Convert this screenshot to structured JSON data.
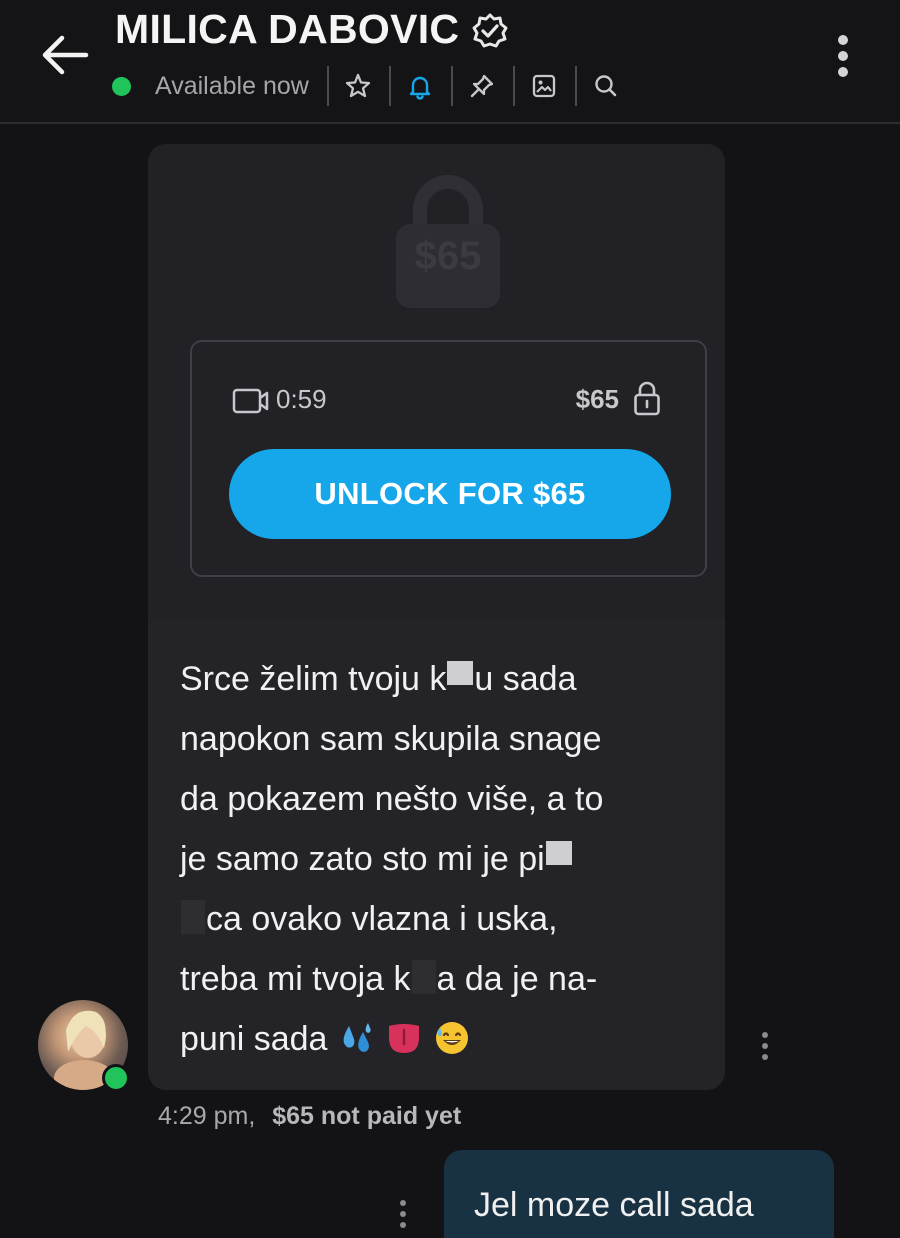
{
  "header": {
    "back_label": "Back",
    "title": "MILICA DABOVIC",
    "status": "Available now",
    "icons": [
      "star-icon",
      "bell-icon",
      "pin-icon",
      "gallery-icon",
      "search-icon"
    ],
    "menu_icon": "more-vertical-icon"
  },
  "locked_media": {
    "background_price": "$65",
    "duration": "0:59",
    "price": "$65",
    "unlock_label": "UNLOCK FOR $65"
  },
  "message": {
    "lines": [
      [
        "Srce želim tvoju k",
        "u sada"
      ],
      [
        "napokon sam skupila snage"
      ],
      [
        "da pokazem nešto više, a to"
      ],
      [
        "je samo zato sto mi je pi"
      ],
      [
        "ca ovako vlazna i uska,"
      ],
      [
        "treba mi tvoja k",
        "a da je na-"
      ],
      [
        "puni sada"
      ]
    ],
    "emojis": [
      "sweat-droplets-icon",
      "tongue-icon",
      "grinning-sweat-icon"
    ],
    "time": "4:29 pm,",
    "payment_status": "$65 not paid yet"
  },
  "outgoing": {
    "text": "Jel moze call sada"
  },
  "colors": {
    "accent": "#16a6ea",
    "online": "#21c35b",
    "outgoing_bubble": "#183243"
  }
}
